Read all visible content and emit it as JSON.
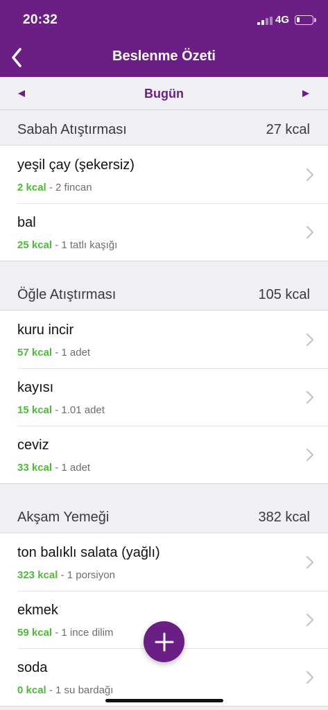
{
  "status_bar": {
    "time": "20:32",
    "network": "4G"
  },
  "nav": {
    "title": "Beslenme Özeti"
  },
  "date": {
    "label": "Bugün"
  },
  "colors": {
    "brand": "#6b1f84",
    "kcal": "#4fb93a"
  },
  "icons": {
    "back": "chevron-left-icon",
    "prev": "caret-left-icon",
    "next": "caret-right-icon",
    "row": "chevron-right-icon",
    "add": "plus-icon"
  },
  "meals": [
    {
      "title": "Sabah Atıştırması",
      "total": "27 kcal",
      "items": [
        {
          "name": "yeşil çay (şekersiz)",
          "kcal": "2 kcal",
          "portion": " - 2 fincan"
        },
        {
          "name": "bal",
          "kcal": "25 kcal",
          "portion": " - 1 tatlı kaşığı"
        }
      ]
    },
    {
      "title": "Öğle Atıştırması",
      "total": "105 kcal",
      "items": [
        {
          "name": "kuru incir",
          "kcal": "57 kcal",
          "portion": " - 1 adet"
        },
        {
          "name": "kayısı",
          "kcal": "15 kcal",
          "portion": " - 1.01 adet"
        },
        {
          "name": "ceviz",
          "kcal": "33 kcal",
          "portion": " - 1 adet"
        }
      ]
    },
    {
      "title": "Akşam Yemeği",
      "total": "382 kcal",
      "items": [
        {
          "name": "ton balıklı salata (yağlı)",
          "kcal": "323 kcal",
          "portion": " - 1 porsiyon"
        },
        {
          "name": "ekmek",
          "kcal": "59 kcal",
          "portion": " - 1 ince dilim"
        },
        {
          "name": "soda",
          "kcal": "0 kcal",
          "portion": " - 1 su bardağı"
        }
      ]
    }
  ]
}
